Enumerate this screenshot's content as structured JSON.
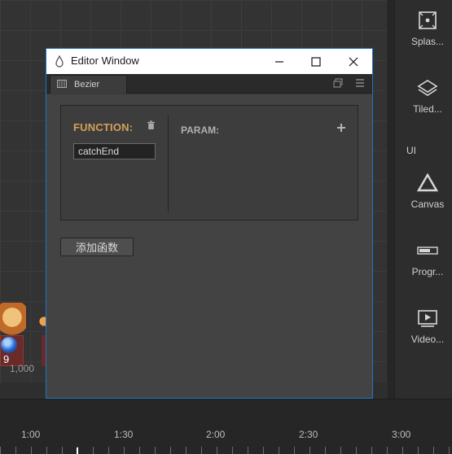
{
  "window": {
    "title": "Editor Window"
  },
  "tab": {
    "label": "Bezier"
  },
  "function_panel": {
    "function_label": "FUNCTION:",
    "function_value": "catchEnd",
    "param_label": "PARAM:"
  },
  "actions": {
    "add_function_label": "添加函数"
  },
  "asset_panel": {
    "section_label": "UI",
    "items": [
      {
        "label": "Splas...",
        "icon": "splash-icon"
      },
      {
        "label": "Tiled...",
        "icon": "tiled-icon"
      },
      {
        "label": "Canvas",
        "icon": "canvas-icon"
      },
      {
        "label": "Progr...",
        "icon": "progress-bar-icon"
      },
      {
        "label": "Video...",
        "icon": "video-icon"
      }
    ]
  },
  "scene": {
    "badge_number": "9",
    "coord_label": "1,000"
  },
  "timeline": {
    "ticks": [
      "1:00",
      "1:30",
      "2:00",
      "2:30",
      "3:00"
    ]
  },
  "colors": {
    "accent_border": "#1f74c7",
    "function_label": "#d4a05a",
    "panel_bg": "#434343"
  }
}
